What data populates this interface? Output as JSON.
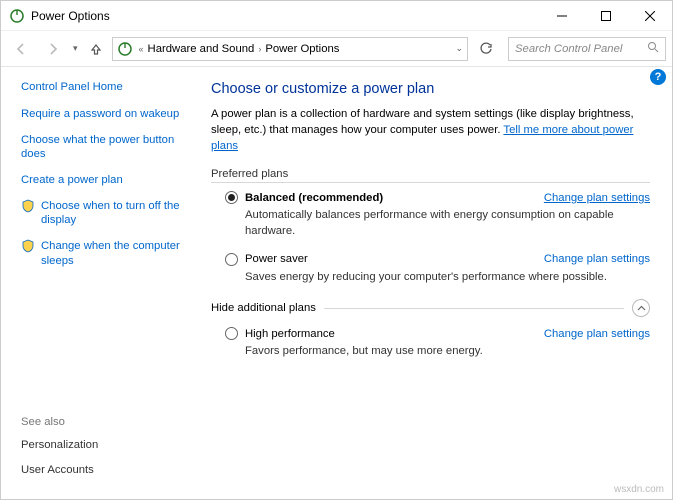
{
  "window": {
    "title": "Power Options"
  },
  "breadcrumb": {
    "item1": "Hardware and Sound",
    "item2": "Power Options"
  },
  "search": {
    "placeholder": "Search Control Panel"
  },
  "sidebar": {
    "home": "Control Panel Home",
    "links": {
      "l0": "Require a password on wakeup",
      "l1": "Choose what the power button does",
      "l2": "Create a power plan",
      "l3": "Choose when to turn off the display",
      "l4": "Change when the computer sleeps"
    },
    "see_also": "See also",
    "footer": {
      "f0": "Personalization",
      "f1": "User Accounts"
    }
  },
  "main": {
    "heading": "Choose or customize a power plan",
    "intro_a": "A power plan is a collection of hardware and system settings (like display brightness, sleep, etc.) that manages how your computer uses power. ",
    "intro_link": "Tell me more about power plans",
    "preferred_label": "Preferred plans",
    "hide_label": "Hide additional plans",
    "change_link": "Change plan settings",
    "plans": {
      "balanced": {
        "name": "Balanced (recommended)",
        "desc": "Automatically balances performance with energy consumption on capable hardware."
      },
      "saver": {
        "name": "Power saver",
        "desc": "Saves energy by reducing your computer's performance where possible."
      },
      "high": {
        "name": "High performance",
        "desc": "Favors performance, but may use more energy."
      }
    }
  },
  "watermark": "wsxdn.com"
}
